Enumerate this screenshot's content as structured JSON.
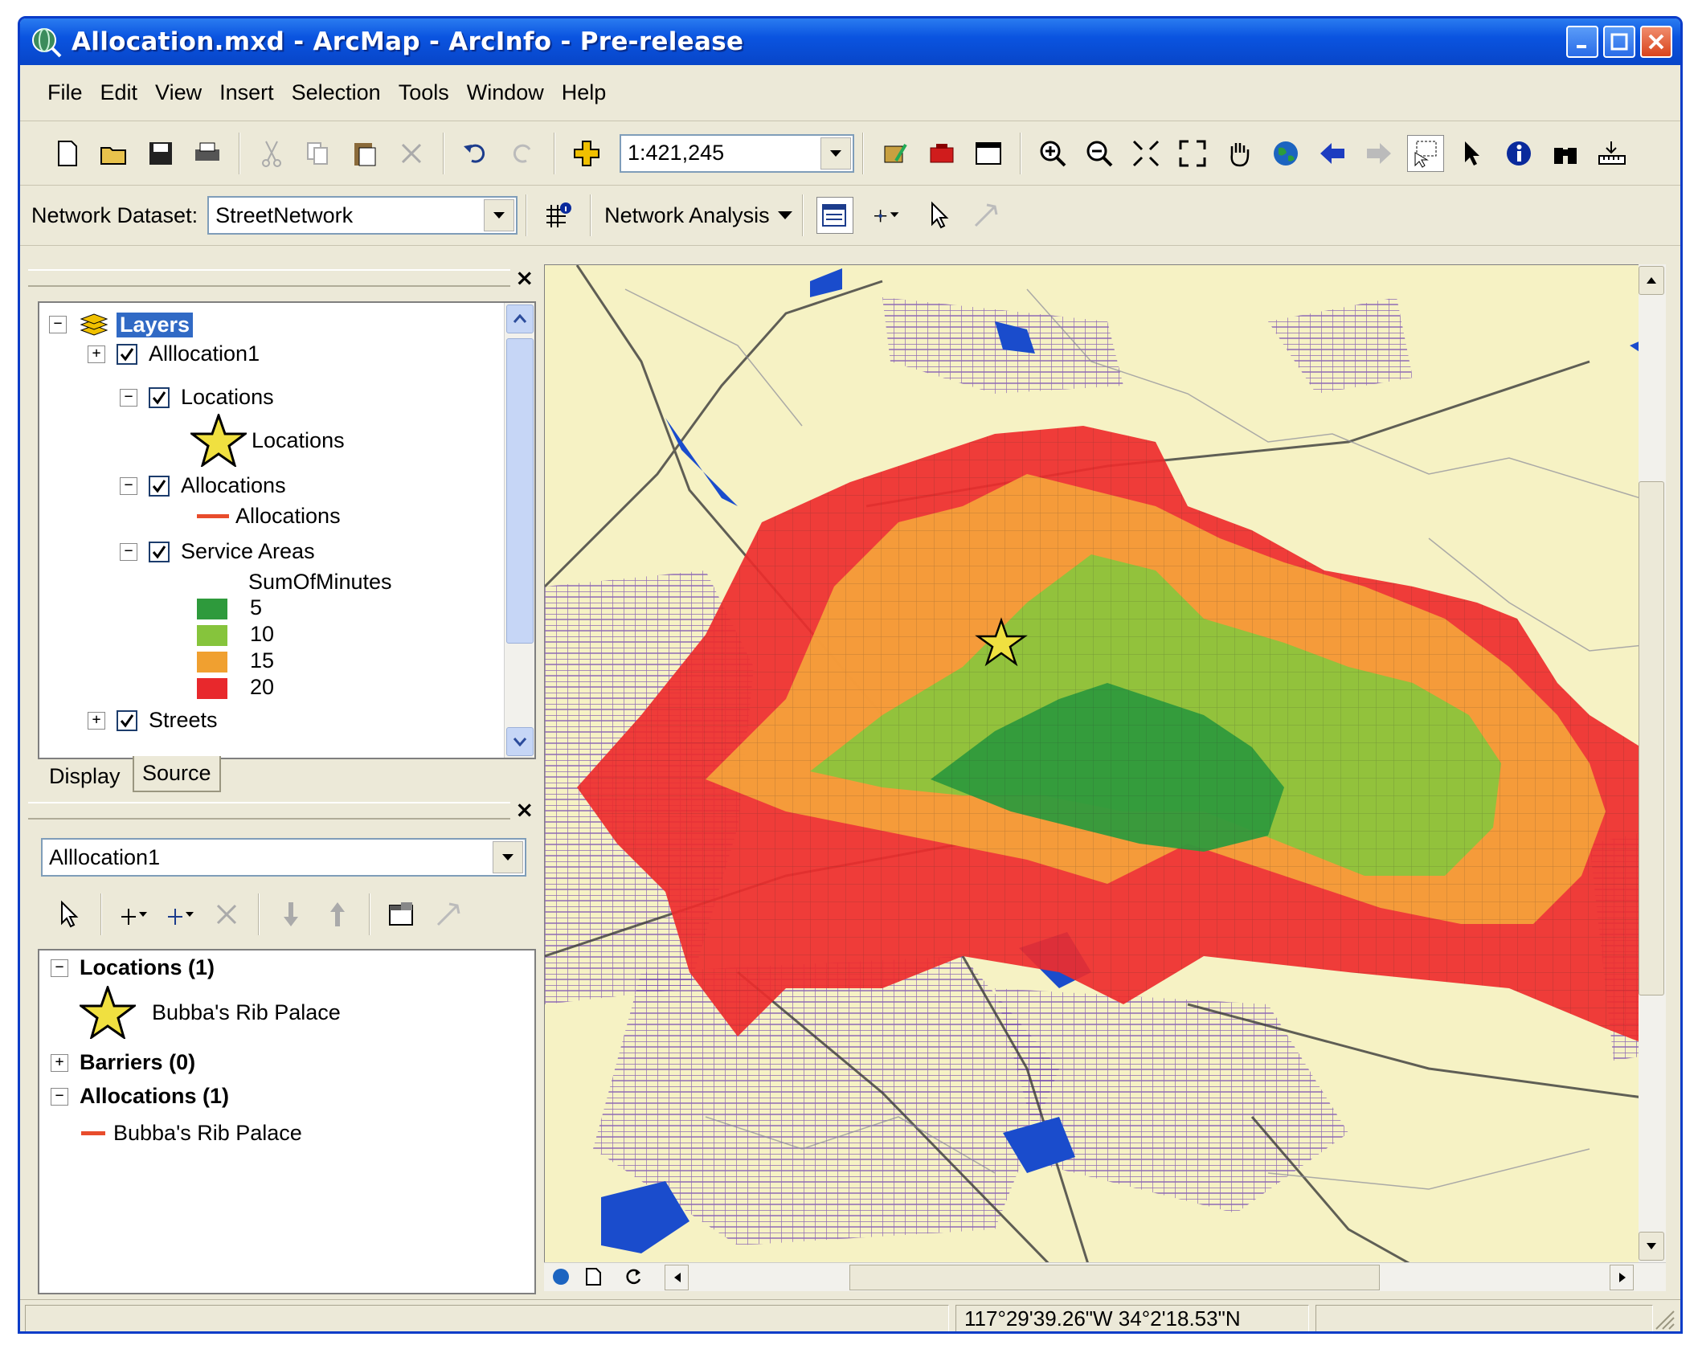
{
  "window": {
    "title": "Allocation.mxd - ArcMap - ArcInfo - Pre-release"
  },
  "menu": [
    "File",
    "Edit",
    "View",
    "Insert",
    "Selection",
    "Tools",
    "Window",
    "Help"
  ],
  "toolbar": {
    "scale": "1:421,245"
  },
  "network_toolbar": {
    "dataset_label": "Network Dataset:",
    "dataset_value": "StreetNetwork",
    "network_analysis_label": "Network Analysis"
  },
  "toc": {
    "root": "Layers",
    "items": [
      {
        "label": "Alllocation1"
      },
      {
        "label": "Locations"
      },
      {
        "label": "Locations"
      },
      {
        "label": "Allocations"
      },
      {
        "label": "Allocations"
      },
      {
        "label": "Service Areas"
      },
      {
        "label": "SumOfMinutes"
      },
      {
        "label": "5"
      },
      {
        "label": "10"
      },
      {
        "label": "15"
      },
      {
        "label": "20"
      },
      {
        "label": "Streets"
      }
    ],
    "tabs": [
      "Display",
      "Source"
    ],
    "colors": {
      "5": "#2e9a3c",
      "10": "#86c43c",
      "15": "#f0a030",
      "20": "#e8282c"
    }
  },
  "na_window": {
    "dropdown_value": "Alllocation1",
    "tree": [
      {
        "label": "Locations (1)"
      },
      {
        "label": "Bubba's Rib Palace"
      },
      {
        "label": "Barriers (0)"
      },
      {
        "label": "Allocations (1)"
      },
      {
        "label": "Bubba's Rib Palace"
      }
    ]
  },
  "status": {
    "coords": "117°29'39.26\"W  34°2'18.53\"N"
  }
}
